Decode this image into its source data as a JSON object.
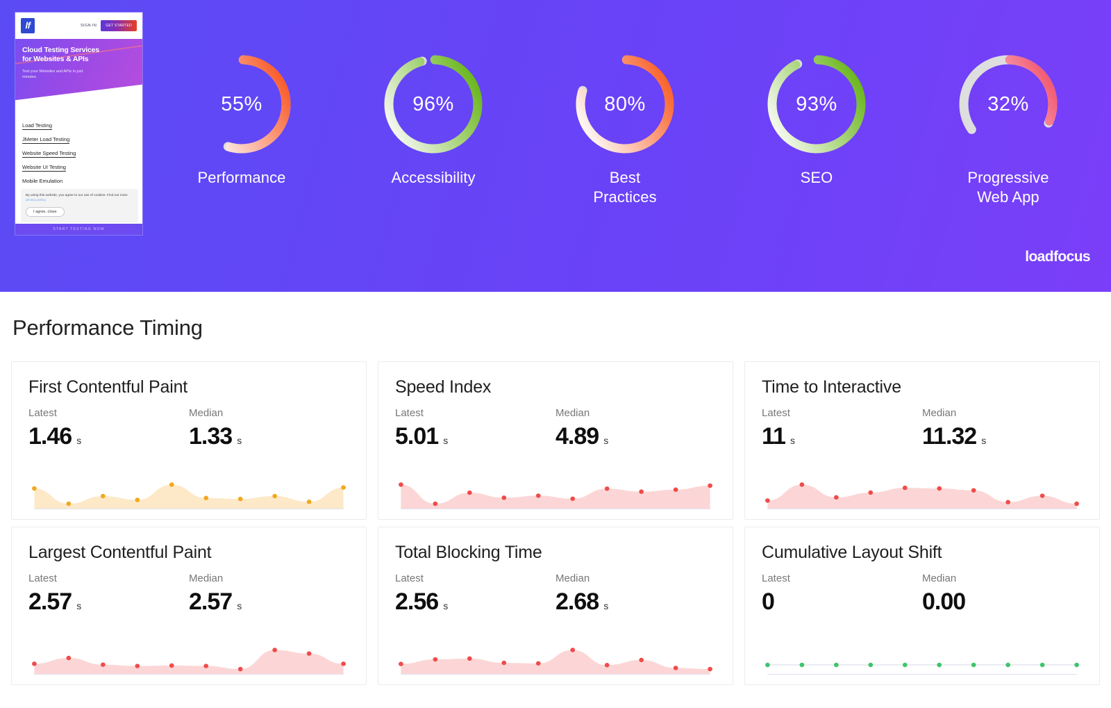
{
  "header": {
    "thumbnail": {
      "logo_text": "lf",
      "sign_in": "SIGN IN",
      "cta": "GET STARTED",
      "hero_title_line1": "Cloud Testing Services",
      "hero_title_line2": "for Websites & APIs",
      "hero_sub": "Test your Websites and APIs in just minutes.",
      "links": [
        "Load Testing",
        "JMeter Load Testing",
        "Website Speed Testing",
        "Website UI Testing",
        "Mobile Emulation"
      ],
      "cookie_text": "By using this website, you agree to our use of cookies. Find out more",
      "cookie_link": "privacy policy.",
      "cookie_button": "I agree, close",
      "bottom_cta": "START TESTING NOW"
    },
    "brand": "loadfocus",
    "background_start": "#5b4bf5",
    "background_end": "#7b3ef9"
  },
  "chart_data": [
    {
      "type": "pie",
      "title": "Lighthouse Category Scores",
      "subtype": "gauge-donut",
      "unit": "%",
      "ylim": [
        0,
        100
      ],
      "categories": [
        "Performance",
        "Accessibility",
        "Best Practices",
        "SEO",
        "Progressive Web App"
      ],
      "values": [
        55,
        96,
        80,
        93,
        32
      ],
      "gauges": [
        {
          "label": "Performance",
          "label_line1": "Performance",
          "label_line2": "",
          "value": 55,
          "display": "55%",
          "color_start": "#fdfdfd",
          "color_end": "#f9531f",
          "track_color": "#dedede"
        },
        {
          "label": "Accessibility",
          "label_line1": "Accessibility",
          "label_line2": "",
          "value": 96,
          "display": "96%",
          "color_start": "#f6f8f2",
          "color_end": "#63b312",
          "track_color": "#dedede"
        },
        {
          "label": "Best Practices",
          "label_line1": "Best",
          "label_line2": "Practices",
          "value": 80,
          "display": "80%",
          "color_start": "#fdfaf8",
          "color_end": "#f95a21",
          "track_color": "#dedede"
        },
        {
          "label": "SEO",
          "label_line1": "SEO",
          "label_line2": "",
          "value": 93,
          "display": "93%",
          "color_start": "#f7faf1",
          "color_end": "#63b312",
          "track_color": "#dedede"
        },
        {
          "label": "Progressive Web App",
          "label_line1": "Progressive",
          "label_line2": "Web App",
          "value": 32,
          "display": "32%",
          "color_start": "#fdfdfd",
          "color_end": "#f2516b",
          "track_color": "#dedede"
        }
      ]
    },
    {
      "type": "area",
      "title": "First Contentful Paint",
      "ylabel": "s",
      "x": [
        1,
        2,
        3,
        4,
        5,
        6,
        7,
        8,
        9,
        10
      ],
      "values": [
        1.46,
        1.3,
        1.38,
        1.34,
        1.5,
        1.36,
        1.35,
        1.38,
        1.32,
        1.47
      ],
      "point_color": "#f2a81e",
      "fill_color": "rgba(247,182,72,0.30)"
    },
    {
      "type": "area",
      "title": "Speed Index",
      "ylabel": "s",
      "x": [
        1,
        2,
        3,
        4,
        5,
        6,
        7,
        8,
        9,
        10
      ],
      "values": [
        5.01,
        4.82,
        4.93,
        4.88,
        4.9,
        4.87,
        4.97,
        4.94,
        4.96,
        5.0
      ],
      "point_color": "#f04b4b",
      "fill_color": "rgba(243,105,105,0.27)"
    },
    {
      "type": "area",
      "title": "Time to Interactive",
      "ylabel": "s",
      "x": [
        1,
        2,
        3,
        4,
        5,
        6,
        7,
        8,
        9,
        10
      ],
      "values": [
        11.0,
        11.5,
        11.1,
        11.25,
        11.4,
        11.38,
        11.32,
        10.95,
        11.15,
        10.9
      ],
      "point_color": "#f04b4b",
      "fill_color": "rgba(243,105,105,0.27)"
    },
    {
      "type": "area",
      "title": "Largest Contentful Paint",
      "ylabel": "s",
      "x": [
        1,
        2,
        3,
        4,
        5,
        6,
        7,
        8,
        9,
        10
      ],
      "values": [
        2.57,
        2.7,
        2.55,
        2.52,
        2.53,
        2.52,
        2.45,
        2.88,
        2.8,
        2.57
      ],
      "point_color": "#f04b4b",
      "fill_color": "rgba(243,105,105,0.27)"
    },
    {
      "type": "area",
      "title": "Total Blocking Time",
      "ylabel": "s",
      "x": [
        1,
        2,
        3,
        4,
        5,
        6,
        7,
        8,
        9,
        10
      ],
      "values": [
        2.56,
        2.72,
        2.75,
        2.6,
        2.58,
        3.05,
        2.52,
        2.7,
        2.42,
        2.38
      ],
      "point_color": "#f04b4b",
      "fill_color": "rgba(243,105,105,0.27)"
    },
    {
      "type": "line",
      "title": "Cumulative Layout Shift",
      "ylabel": "",
      "x": [
        1,
        2,
        3,
        4,
        5,
        6,
        7,
        8,
        9,
        10
      ],
      "values": [
        0,
        0,
        0,
        0,
        0,
        0,
        0,
        0,
        0,
        0
      ],
      "point_color": "#3ec46d",
      "fill_color": "none"
    }
  ],
  "timing": {
    "section_title": "Performance Timing",
    "latest_label": "Latest",
    "median_label": "Median",
    "cards": [
      {
        "title": "First Contentful Paint",
        "latest": "1.46",
        "latest_unit": "s",
        "median": "1.33",
        "median_unit": "s"
      },
      {
        "title": "Speed Index",
        "latest": "5.01",
        "latest_unit": "s",
        "median": "4.89",
        "median_unit": "s"
      },
      {
        "title": "Time to Interactive",
        "latest": "11",
        "latest_unit": "s",
        "median": "11.32",
        "median_unit": "s"
      },
      {
        "title": "Largest Contentful Paint",
        "latest": "2.57",
        "latest_unit": "s",
        "median": "2.57",
        "median_unit": "s"
      },
      {
        "title": "Total Blocking Time",
        "latest": "2.56",
        "latest_unit": "s",
        "median": "2.68",
        "median_unit": "s"
      },
      {
        "title": "Cumulative Layout Shift",
        "latest": "0",
        "latest_unit": "",
        "median": "0.00",
        "median_unit": ""
      }
    ]
  }
}
